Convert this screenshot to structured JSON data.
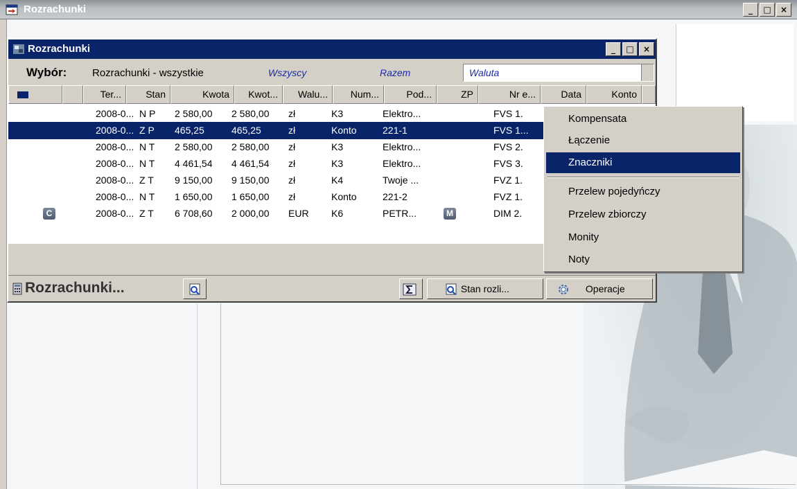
{
  "app": {
    "title": "Rozrachunki",
    "controls": [
      "_",
      "□",
      "×"
    ]
  },
  "child_window": {
    "title": "Rozrachunki",
    "controls": [
      "_",
      "□",
      "×"
    ],
    "filter": {
      "label": "Wybór:",
      "value": "Rozrachunki - wszystkie",
      "who": "Wszyscy",
      "sum": "Razem",
      "currency_placeholder": "Waluta"
    },
    "columns": [
      "Ter...",
      "Stan",
      "Kwota",
      "Kwot...",
      "Walu...",
      "Num...",
      "Pod...",
      "ZP",
      "Nr e...",
      "Data",
      "Konto"
    ],
    "rows": [
      {
        "badge": "",
        "ter": "2008-0...",
        "stan": "N P",
        "kwota": "2 580,00",
        "kwot": "2 580,00",
        "walu": "zł",
        "num": "K3",
        "pod": "Elektro...",
        "zp": "",
        "nr": "FVS 1."
      },
      {
        "badge": "",
        "ter": "2008-0...",
        "stan": "Z P",
        "kwota": "465,25",
        "kwot": "465,25",
        "walu": "zł",
        "num": "Konto",
        "pod": "221-1",
        "zp": "",
        "nr": "FVS 1..."
      },
      {
        "badge": "",
        "ter": "2008-0...",
        "stan": "N T",
        "kwota": "2 580,00",
        "kwot": "2 580,00",
        "walu": "zł",
        "num": "K3",
        "pod": "Elektro...",
        "zp": "",
        "nr": "FVS 2."
      },
      {
        "badge": "",
        "ter": "2008-0...",
        "stan": "N T",
        "kwota": "4 461,54",
        "kwot": "4 461,54",
        "walu": "zł",
        "num": "K3",
        "pod": "Elektro...",
        "zp": "",
        "nr": "FVS 3."
      },
      {
        "badge": "",
        "ter": "2008-0...",
        "stan": "Z T",
        "kwota": "9 150,00",
        "kwot": "9 150,00",
        "walu": "zł",
        "num": "K4",
        "pod": "Twoje ...",
        "zp": "",
        "nr": "FVZ 1."
      },
      {
        "badge": "",
        "ter": "2008-0...",
        "stan": "N T",
        "kwota": "1 650,00",
        "kwot": "1 650,00",
        "walu": "zł",
        "num": "Konto",
        "pod": "221-2",
        "zp": "",
        "nr": "FVZ 1."
      },
      {
        "badge": "C",
        "ter": "2008-0...",
        "stan": "Z T",
        "kwota": "6 708,60",
        "kwot": "2 000,00",
        "walu": "EUR",
        "num": "K6",
        "pod": "PETR...",
        "zp": "M",
        "nr": "DIM 2."
      }
    ],
    "selected_row": 1,
    "toolbar": {
      "title": "Rozrachunki...",
      "stan_button": "Stan rozli...",
      "operacje_button": "Operacje"
    }
  },
  "context_menu": {
    "items": [
      {
        "label": "Kompensata",
        "active": false
      },
      {
        "label": "Łączenie",
        "active": false
      },
      {
        "label": "Znaczniki",
        "active": true
      },
      {
        "label": "Przelew pojedyńczy",
        "active": false
      },
      {
        "label": "Przelew zbiorczy",
        "active": false
      },
      {
        "label": "Monity",
        "active": false
      },
      {
        "label": "Noty",
        "active": false
      }
    ]
  },
  "colors": {
    "selection": "#0a246a",
    "face": "#d4d0c8",
    "italic_link": "#1a2aa8"
  }
}
